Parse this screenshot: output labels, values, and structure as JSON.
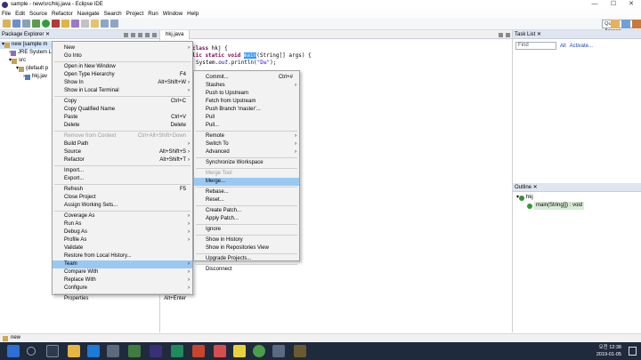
{
  "window": {
    "title": "sample - new/src/hkj.java - Eclipse IDE",
    "controls": [
      "—",
      "☐",
      "✕"
    ]
  },
  "menubar": [
    "File",
    "Edit",
    "Source",
    "Refactor",
    "Navigate",
    "Search",
    "Project",
    "Run",
    "Window",
    "Help"
  ],
  "toolbar": {
    "quick_access_placeholder": "Quick Access"
  },
  "package_explorer": {
    "tab_label": "Package Explorer ✕",
    "tree": [
      {
        "label": "new [sample m",
        "depth": 0,
        "selected": true
      },
      {
        "label": "JRE System L",
        "depth": 1
      },
      {
        "label": "src",
        "depth": 1
      },
      {
        "label": "(default p",
        "depth": 2
      },
      {
        "label": "hkj.jav",
        "depth": 3
      }
    ]
  },
  "editor": {
    "tab_label": "hkj.java",
    "code_lines": [
      [
        "kw:class",
        "txt: hkj {"
      ],
      [
        "kw:lic static void ",
        "hl:main",
        "txt:(String[] args) {"
      ],
      [
        "txt:System.",
        "fld:out",
        "txt:.println(",
        "str:\"D≡\"",
        "txt:);"
      ],
      [
        "txt:"
      ]
    ]
  },
  "task_list": {
    "tab_label": "Task List ✕",
    "find_placeholder": "Find",
    "all_label": "All",
    "activate_label": "Activate..."
  },
  "outline": {
    "tab_label": "Outline ✕",
    "items": [
      {
        "label": "hkj",
        "depth": 0
      },
      {
        "label": "main(String[]) : void",
        "depth": 1
      }
    ]
  },
  "status": {
    "text": "new"
  },
  "taskbar": {
    "time": "오전 12:38",
    "date": "2019-01-05"
  },
  "context_menu": {
    "items": [
      {
        "label": "New",
        "arrow": true
      },
      {
        "label": "Go Into"
      },
      {
        "sep": true
      },
      {
        "label": "Open in New Window"
      },
      {
        "label": "Open Type Hierarchy",
        "shortcut": "F4"
      },
      {
        "label": "Show In",
        "shortcut": "Alt+Shift+W",
        "arrow": true
      },
      {
        "label": "Show in Local Terminal",
        "arrow": true
      },
      {
        "sep": true
      },
      {
        "label": "Copy",
        "shortcut": "Ctrl+C"
      },
      {
        "label": "Copy Qualified Name"
      },
      {
        "label": "Paste",
        "shortcut": "Ctrl+V"
      },
      {
        "label": "Delete",
        "shortcut": "Delete"
      },
      {
        "sep": true
      },
      {
        "label": "Remove from Context",
        "shortcut": "Ctrl+Alt+Shift+Down",
        "disabled": true
      },
      {
        "label": "Build Path",
        "arrow": true
      },
      {
        "label": "Source",
        "shortcut": "Alt+Shift+S",
        "arrow": true
      },
      {
        "label": "Refactor",
        "shortcut": "Alt+Shift+T",
        "arrow": true
      },
      {
        "sep": true
      },
      {
        "label": "Import..."
      },
      {
        "label": "Export..."
      },
      {
        "sep": true
      },
      {
        "label": "Refresh",
        "shortcut": "F5"
      },
      {
        "label": "Close Project"
      },
      {
        "label": "Assign Working Sets..."
      },
      {
        "sep": true
      },
      {
        "label": "Coverage As",
        "arrow": true
      },
      {
        "label": "Run As",
        "arrow": true
      },
      {
        "label": "Debug As",
        "arrow": true
      },
      {
        "label": "Profile As",
        "arrow": true
      },
      {
        "label": "Validate"
      },
      {
        "label": "Restore from Local History..."
      },
      {
        "label": "Team",
        "arrow": true,
        "hover": true
      },
      {
        "label": "Compare With",
        "arrow": true
      },
      {
        "label": "Replace With",
        "arrow": true
      },
      {
        "label": "Configure",
        "arrow": true
      },
      {
        "sep": true
      },
      {
        "label": "Properties",
        "shortcut": "Alt+Enter"
      }
    ]
  },
  "team_submenu": {
    "items": [
      {
        "label": "Commit...",
        "shortcut": "Ctrl+#"
      },
      {
        "label": "Stashes",
        "arrow": true
      },
      {
        "label": "Push to Upstream"
      },
      {
        "label": "Fetch from Upstream"
      },
      {
        "label": "Push Branch 'master'..."
      },
      {
        "label": "Pull"
      },
      {
        "label": "Pull..."
      },
      {
        "sep": true
      },
      {
        "label": "Remote",
        "arrow": true
      },
      {
        "label": "Switch To",
        "arrow": true
      },
      {
        "label": "Advanced",
        "arrow": true
      },
      {
        "sep": true
      },
      {
        "label": "Synchronize Workspace"
      },
      {
        "sep": true
      },
      {
        "label": "Merge Tool",
        "disabled": true
      },
      {
        "label": "Merge...",
        "hover": true
      },
      {
        "sep": true
      },
      {
        "label": "Rebase..."
      },
      {
        "label": "Reset..."
      },
      {
        "sep": true
      },
      {
        "label": "Create Patch..."
      },
      {
        "label": "Apply Patch..."
      },
      {
        "sep": true
      },
      {
        "label": "Ignore"
      },
      {
        "sep": true
      },
      {
        "label": "Show in History"
      },
      {
        "label": "Show in Repositories View"
      },
      {
        "sep": true
      },
      {
        "label": "Upgrade Projects..."
      },
      {
        "sep": true
      },
      {
        "label": "Disconnect"
      }
    ]
  }
}
